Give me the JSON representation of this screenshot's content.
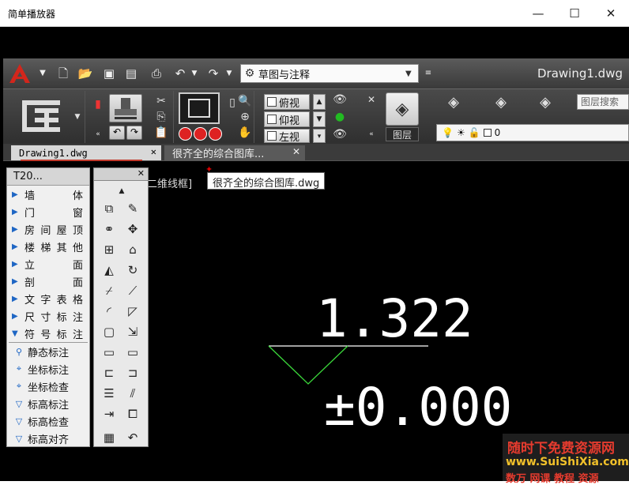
{
  "window": {
    "title": "简单播放器",
    "minimize": "—",
    "maximize": "☐",
    "close": "✕"
  },
  "app": {
    "workspace": "草图与注释",
    "document_title": "Drawing1.dwg",
    "ribbon": {
      "views": [
        "俯视",
        "仰视",
        "左视"
      ],
      "layers_label": "图层",
      "layer_search": "图层搜索",
      "current_layer": "0"
    },
    "tabs": [
      {
        "label": "Drawing1.dwg",
        "active": true
      },
      {
        "label": "很齐全的综合图库...",
        "active": false
      }
    ],
    "tooltip": "很齐全的综合图库.dwg",
    "viewport_label": "二维线框]",
    "t20_panel": {
      "title": "T20...",
      "menu_items": [
        "墙体",
        "门窗",
        "房间屋顶",
        "楼梯其他",
        "立面",
        "剖面",
        "文字表格",
        "尺寸标注",
        "符号标注"
      ],
      "sub_items": [
        "静态标注",
        "坐标标注",
        "坐标检查",
        "标高标注",
        "标高检查",
        "标高对齐"
      ]
    },
    "drawing": {
      "elevation_value": "1.322",
      "datum_value": "±0.000",
      "line_color": "#ffffff",
      "triangle_color": "#3ad63a"
    }
  },
  "watermark": {
    "line1": "随时下免费资源网",
    "line2": "www.SuiShiXia.com",
    "line3": "数万 网课 教程 资源"
  }
}
